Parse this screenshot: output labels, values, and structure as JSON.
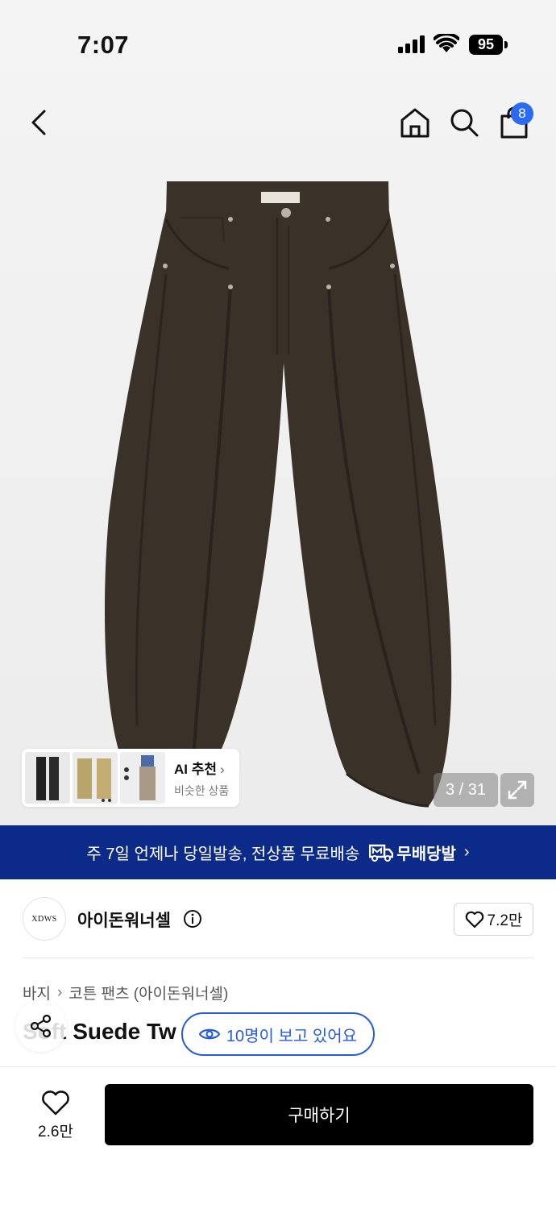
{
  "status_bar": {
    "time": "7:07",
    "battery": "95"
  },
  "nav": {
    "cart_count": "8",
    "icons": [
      "back-icon",
      "home-icon",
      "search-icon",
      "cart-icon"
    ]
  },
  "gallery": {
    "ai_card": {
      "title": "AI 추천",
      "chevron": "›",
      "subtitle": "비슷한 상품"
    },
    "counter": "3 / 31"
  },
  "banner": {
    "text": "주 7일 언제나 당일발송, 전상품 무료배송",
    "badge": "무배당발",
    "chevron": "›"
  },
  "brand": {
    "logo_text": "XDWS",
    "name": "아이돈워너셀",
    "likes": "7.2만"
  },
  "breadcrumb": {
    "category": "바지",
    "separator": "›",
    "subcategory": "코튼 팬츠 (아이돈워너셀)"
  },
  "product": {
    "title": "Soft Suede Tw"
  },
  "viewers": {
    "text": "10명이 보고 있어요"
  },
  "bottom_bar": {
    "wish_count": "2.6만",
    "buy_label": "구매하기"
  },
  "colors": {
    "banner": "#0c2a87",
    "badge": "#2a6bf2",
    "accent_blue": "#2a5bd7",
    "pants": "#3a3129"
  }
}
